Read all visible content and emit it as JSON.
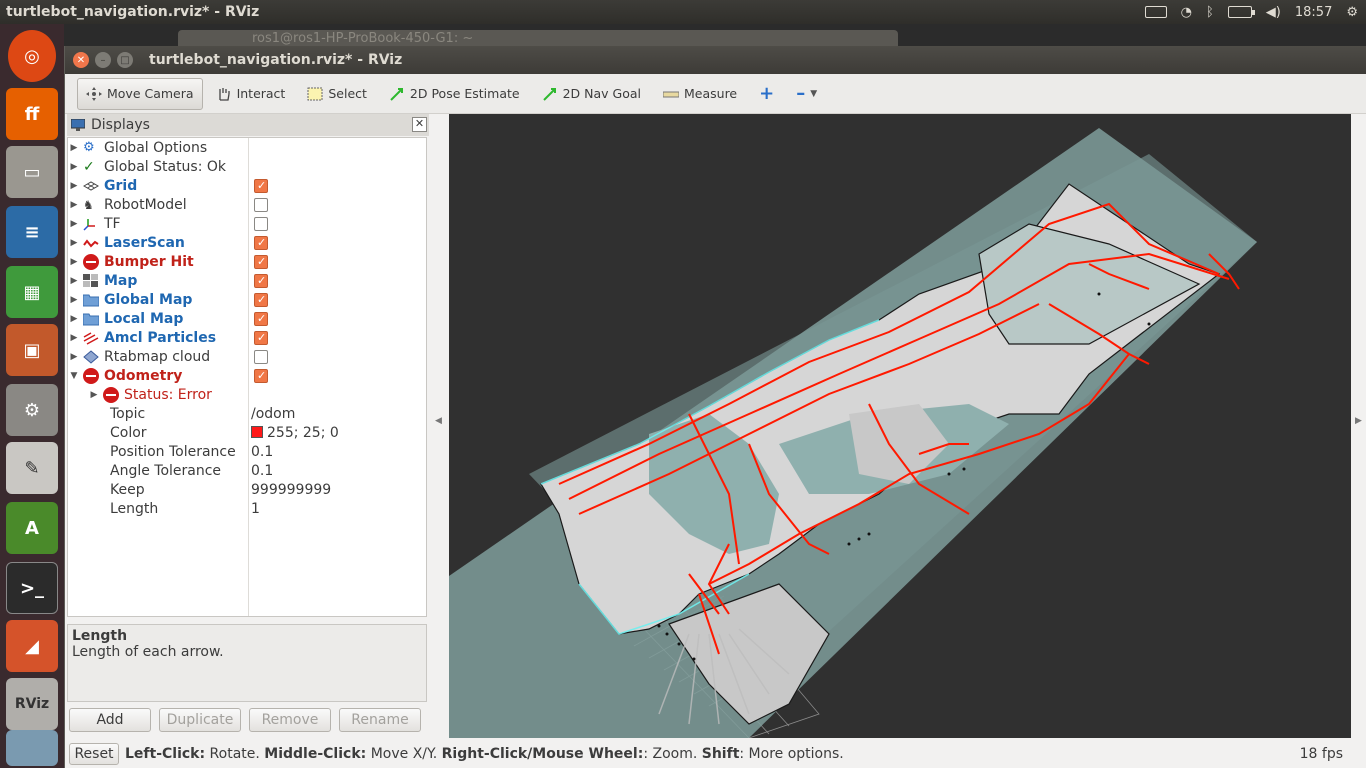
{
  "system": {
    "title": "turtlebot_navigation.rviz* - RViz",
    "clock": "18:57"
  },
  "background_window": {
    "title": "ros1@ros1-HP-ProBook-450-G1: ~"
  },
  "window": {
    "title": "turtlebot_navigation.rviz* - RViz"
  },
  "toolbar": {
    "tools": [
      {
        "label": "Move Camera",
        "icon": "move-camera-icon",
        "active": true
      },
      {
        "label": "Interact",
        "icon": "hand-icon"
      },
      {
        "label": "Select",
        "icon": "select-icon"
      },
      {
        "label": "2D Pose Estimate",
        "icon": "green-arrow-icon"
      },
      {
        "label": "2D Nav Goal",
        "icon": "green-arrow-icon"
      },
      {
        "label": "Measure",
        "icon": "ruler-icon"
      }
    ]
  },
  "displays": {
    "header": "Displays",
    "items": [
      {
        "name": "Global Options",
        "icon": "gear-icon"
      },
      {
        "name": "Global Status: Ok",
        "icon": "check-icon"
      },
      {
        "name": "Grid",
        "icon": "grid-icon",
        "checked": true
      },
      {
        "name": "RobotModel",
        "icon": "robot-icon",
        "checked": false
      },
      {
        "name": "TF",
        "icon": "tf-icon",
        "checked": false
      },
      {
        "name": "LaserScan",
        "icon": "laser-icon",
        "checked": true
      },
      {
        "name": "Bumper Hit",
        "icon": "error-icon",
        "checked": true
      },
      {
        "name": "Map",
        "icon": "map-icon",
        "checked": true
      },
      {
        "name": "Global Map",
        "icon": "folder-icon",
        "checked": true
      },
      {
        "name": "Local Map",
        "icon": "folder-icon",
        "checked": true
      },
      {
        "name": "Amcl Particles",
        "icon": "particles-icon",
        "checked": true
      },
      {
        "name": "Rtabmap cloud",
        "icon": "cloud-icon",
        "checked": false
      },
      {
        "name": "Odometry",
        "icon": "error-icon",
        "checked": true
      }
    ],
    "odometry": {
      "status": "Status: Error",
      "props": [
        {
          "key": "Topic",
          "value": "/odom"
        },
        {
          "key": "Color",
          "value": "255; 25; 0"
        },
        {
          "key": "Position Tolerance",
          "value": "0.1"
        },
        {
          "key": "Angle Tolerance",
          "value": "0.1"
        },
        {
          "key": "Keep",
          "value": "999999999"
        },
        {
          "key": "Length",
          "value": "1"
        }
      ]
    },
    "description": {
      "title": "Length",
      "text": "Length of each arrow."
    },
    "buttons": {
      "add": "Add",
      "duplicate": "Duplicate",
      "remove": "Remove",
      "rename": "Rename"
    }
  },
  "statusbar": {
    "reset": "Reset",
    "hint_parts": [
      {
        "bold": "Left-Click:",
        "text": " Rotate. "
      },
      {
        "bold": "Middle-Click:",
        "text": " Move X/Y. "
      },
      {
        "bold": "Right-Click/Mouse Wheel:",
        "text": ": Zoom. "
      },
      {
        "bold": "Shift",
        "text": ": More options."
      }
    ],
    "fps": "18 fps"
  },
  "colors": {
    "odometry_arrows": "#ff1900",
    "plane": "#7f9d9b",
    "viewport_bg": "#303030"
  }
}
